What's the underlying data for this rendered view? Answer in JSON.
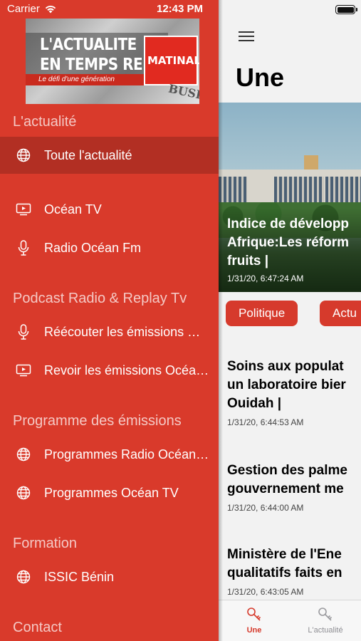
{
  "status_bar": {
    "carrier": "Carrier",
    "time": "12:43 PM"
  },
  "drawer": {
    "banner": {
      "line1": "L'ACTUALITE",
      "line2": "EN TEMPS REEL",
      "tagline": "Le défi d'une génération",
      "logo": "MATINAL",
      "paper_text": "BUSINE"
    },
    "sections": [
      {
        "title": "L'actualité",
        "items": [
          {
            "label": "Toute l'actualité",
            "icon": "globe-icon",
            "active": true
          }
        ]
      },
      {
        "title": "",
        "items": [
          {
            "label": "Océan TV",
            "icon": "tv-icon"
          },
          {
            "label": "Radio Océan Fm",
            "icon": "microphone-icon"
          }
        ]
      },
      {
        "title": "Podcast Radio & Replay Tv",
        "items": [
          {
            "label": "Réécouter les émissions Radio Océan Fm",
            "icon": "microphone-icon"
          },
          {
            "label": "Revoir les émissions Océan TV",
            "icon": "tv-icon"
          }
        ]
      },
      {
        "title": "Programme des émissions",
        "items": [
          {
            "label": "Programmes Radio Océan Fm",
            "icon": "globe-icon"
          },
          {
            "label": "Programmes Océan TV",
            "icon": "globe-icon"
          }
        ]
      },
      {
        "title": "Formation",
        "items": [
          {
            "label": "ISSIC Bénin",
            "icon": "globe-icon"
          }
        ]
      },
      {
        "title": "Contact",
        "items": []
      }
    ]
  },
  "main": {
    "menu_icon": "hamburger-icon",
    "title": "Une",
    "hero": {
      "title": "Indice de développement humain en Afrique:Les réformes ... fruits |",
      "title_visible": "Indice de développ\nAfrique:Les réform\nfruits |",
      "date": "1/31/20, 6:47:24 AM"
    },
    "categories": [
      "Politique",
      "Actu"
    ],
    "articles": [
      {
        "title_line1": "Soins aux populat",
        "title_line2": "un laboratoire bier",
        "title_line3": "Ouidah |",
        "date": "1/31/20, 6:44:53 AM"
      },
      {
        "title_line1": "Gestion des palme",
        "title_line2": "gouvernement me",
        "title_line3": "",
        "date": "1/31/20, 6:44:00 AM"
      },
      {
        "title_line1": "Ministère de l'Ene",
        "title_line2": "qualitatifs faits en",
        "title_line3": "",
        "date": "1/31/20, 6:43:05 AM"
      }
    ],
    "tabs": [
      {
        "label": "Une",
        "icon": "key-icon",
        "active": true,
        "color": "#d63a2c"
      },
      {
        "label": "L'actualité",
        "icon": "key-icon",
        "active": false,
        "color": "#8e8e93"
      }
    ]
  },
  "colors": {
    "drawer_bg": "#d93a2b",
    "accent": "#d63a2c",
    "main_bg": "#f2f2f2"
  }
}
